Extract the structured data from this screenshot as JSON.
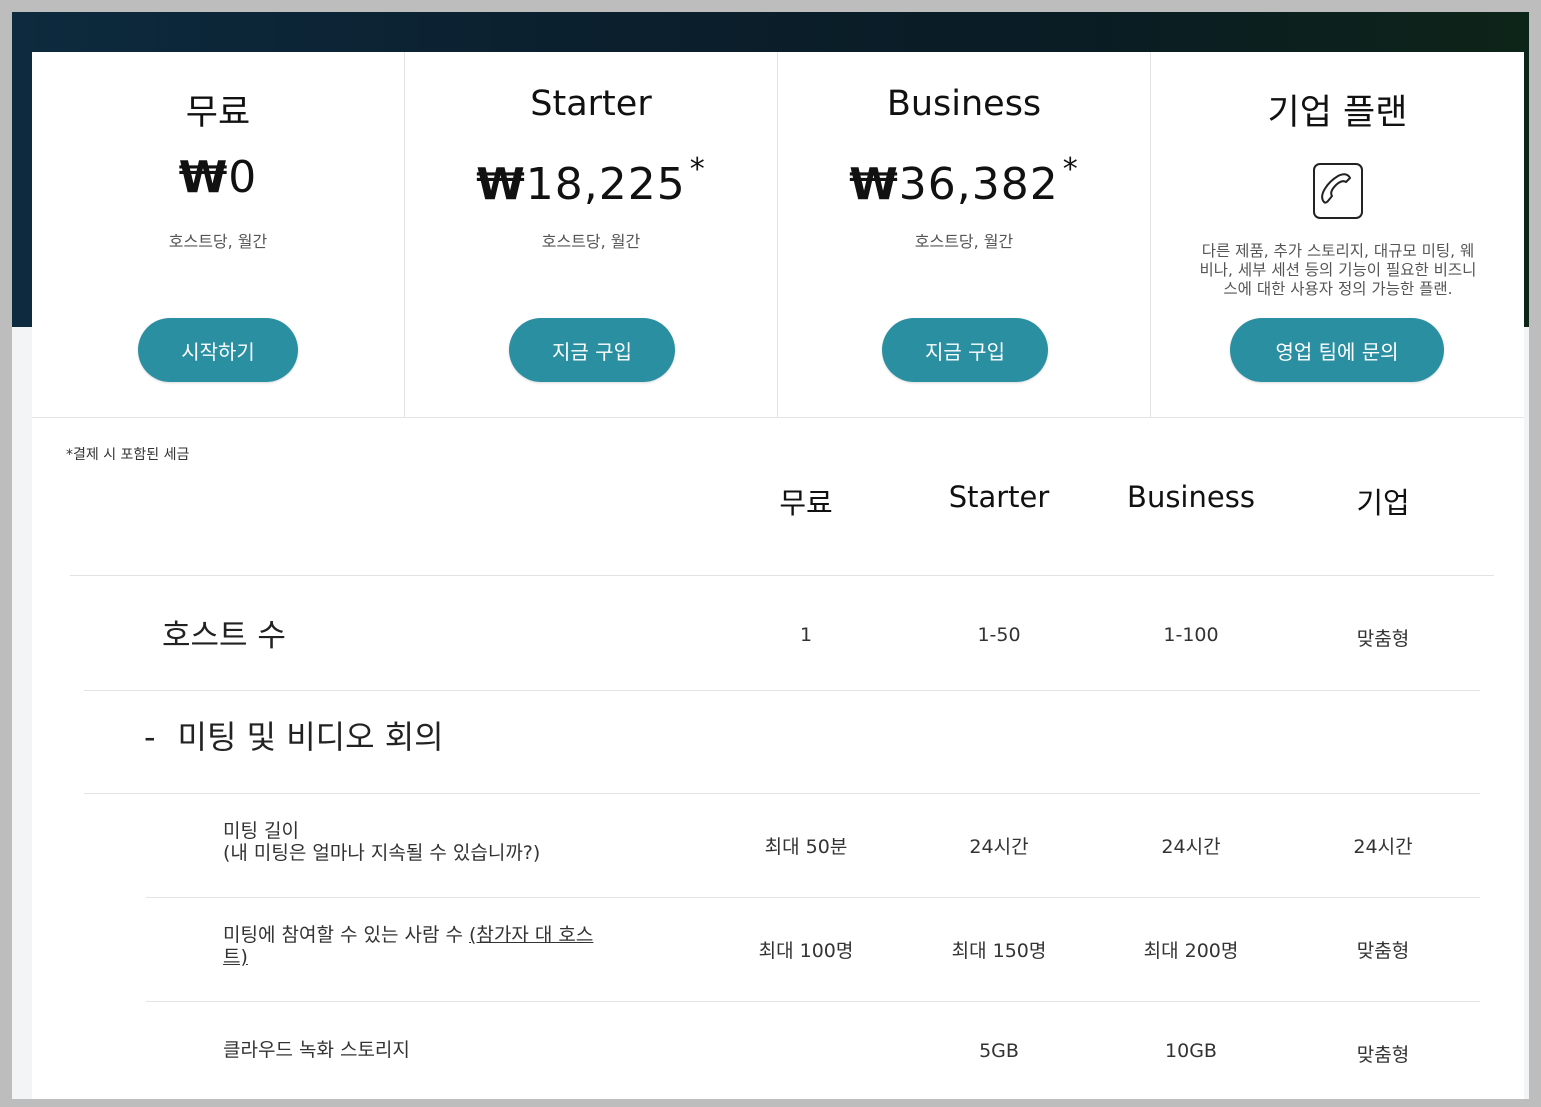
{
  "plans": [
    {
      "name": "무료",
      "currency": "₩",
      "amount": "0",
      "star": "",
      "unit": "호스트당, 월간",
      "button": "시작하기"
    },
    {
      "name": "Starter",
      "currency": "₩",
      "amount": "18,225",
      "star": "*",
      "unit": "호스트당, 월간",
      "button": "지금 구입"
    },
    {
      "name": "Business",
      "currency": "₩",
      "amount": "36,382",
      "star": "*",
      "unit": "호스트당, 월간",
      "button": "지금 구입"
    },
    {
      "name": "기업 플랜",
      "icon": "phone-icon",
      "description": "다른 제품, 추가 스토리지, 대규모 미팅, 웨비나, 세부 세션 등의 기능이 필요한 비즈니스에 대한 사용자 정의 가능한 플랜.",
      "button": "영업 팀에 문의"
    }
  ],
  "tax_note": "*결제 시 포함된 세금",
  "columns": [
    "무료",
    "Starter",
    "Business",
    "기업"
  ],
  "hosts_row": {
    "label": "호스트 수",
    "values": [
      "1",
      "1-50",
      "1-100",
      "맞춤형"
    ]
  },
  "section": {
    "toggle": "-",
    "title": "미팅 및 비디오 회의"
  },
  "features": [
    {
      "label_line1": "미팅 길이",
      "label_line2": "(내 미팅은 얼마나 지속될 수 있습니까?)",
      "values": [
        "최대 50분",
        "24시간",
        "24시간",
        "24시간"
      ]
    },
    {
      "label_text": "미팅에 참여할 수 있는 사람 수 ",
      "label_link": "(참가자 대 호스트)",
      "values": [
        "최대 100명",
        "최대 150명",
        "최대 200명",
        "맞춤형"
      ]
    },
    {
      "label_line1": "클라우드 녹화 스토리지",
      "values": [
        "",
        "5GB",
        "10GB",
        "맞춤형"
      ]
    }
  ],
  "colors": {
    "button": "#2b8fa2",
    "hero_dark": "#0b1f2d"
  }
}
